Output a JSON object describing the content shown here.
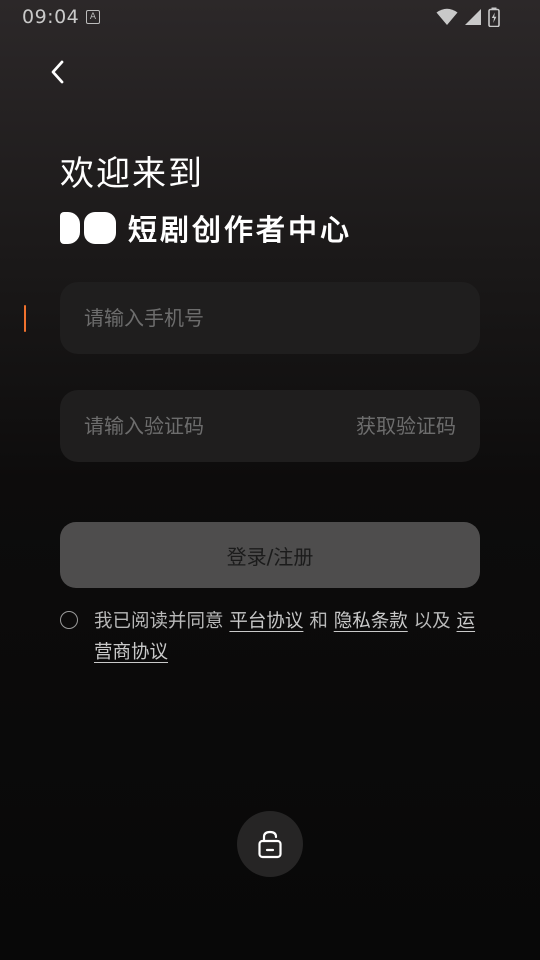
{
  "status_bar": {
    "time": "09:04",
    "app_indicator": "A",
    "icons": [
      "wifi-icon",
      "signal-icon",
      "battery-icon"
    ]
  },
  "header": {
    "back_icon": "chevron-left-icon"
  },
  "welcome": {
    "title": "欢迎来到",
    "brand_name": "短剧创作者中心"
  },
  "form": {
    "phone_placeholder": "请输入手机号",
    "phone_value": "",
    "code_placeholder": "请输入验证码",
    "code_value": "",
    "get_code_label": "获取验证码",
    "submit_label": "登录/注册"
  },
  "agreement": {
    "checked": false,
    "prefix": "我已阅读并同意",
    "link_platform": "平台协议",
    "and": "和",
    "link_privacy": "隐私条款",
    "and_also": "以及",
    "link_operator": "运营商协议"
  },
  "bottom": {
    "lock_icon": "lock-icon"
  },
  "colors": {
    "accent_caret": "#f0722e",
    "input_bg": "#1f1e1e",
    "button_bg": "#4e4d4d",
    "placeholder": "#6d6d6d"
  }
}
